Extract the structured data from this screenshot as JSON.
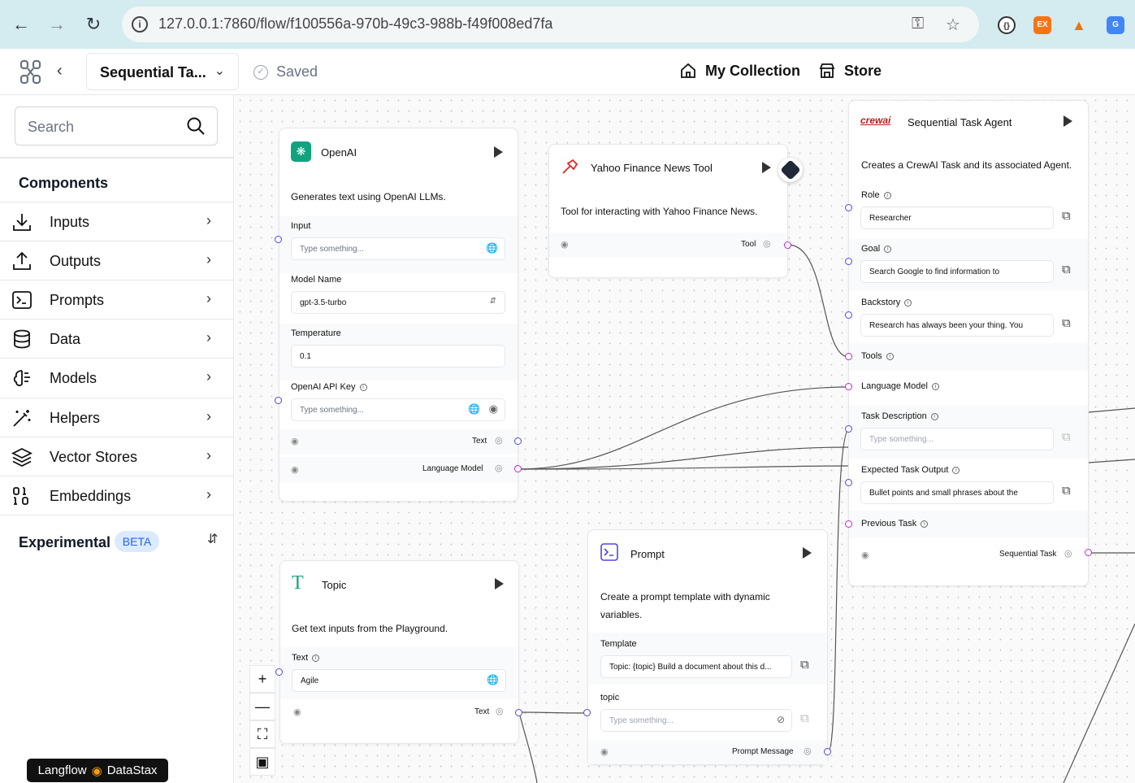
{
  "browser": {
    "url": "127.0.0.1:7860/flow/f100556a-970b-49c3-988b-f49f008ed7fa",
    "ext_ex": "EX"
  },
  "header": {
    "flow_name": "Sequential Ta...",
    "saved": "Saved",
    "my_collection": "My Collection",
    "store": "Store"
  },
  "sidebar": {
    "search_placeholder": "Search",
    "components_title": "Components",
    "items": [
      {
        "label": "Inputs",
        "icon": "download-icon"
      },
      {
        "label": "Outputs",
        "icon": "upload-icon"
      },
      {
        "label": "Prompts",
        "icon": "terminal-icon"
      },
      {
        "label": "Data",
        "icon": "database-icon"
      },
      {
        "label": "Models",
        "icon": "brain-icon"
      },
      {
        "label": "Helpers",
        "icon": "wand-icon"
      },
      {
        "label": "Vector Stores",
        "icon": "layers-icon"
      },
      {
        "label": "Embeddings",
        "icon": "binary-icon"
      }
    ],
    "experimental": "Experimental",
    "beta": "BETA"
  },
  "brand": {
    "left": "Langflow",
    "right": "DataStax"
  },
  "nodes": {
    "openai": {
      "title": "OpenAI",
      "description": "Generates text using OpenAI LLMs.",
      "input_label": "Input",
      "input_placeholder": "Type something...",
      "model_label": "Model Name",
      "model_value": "gpt-3.5-turbo",
      "temperature_label": "Temperature",
      "temperature_value": "0.1",
      "apikey_label": "OpenAI API Key",
      "apikey_placeholder": "Type something...",
      "out_text": "Text",
      "out_lm": "Language Model"
    },
    "yahoo": {
      "title": "Yahoo Finance News Tool",
      "description": "Tool for interacting with Yahoo Finance News.",
      "out_tool": "Tool"
    },
    "agent": {
      "title": "Sequential Task Agent",
      "logo_text": "crewai",
      "description": "Creates a CrewAI Task and its associated Agent.",
      "role_label": "Role",
      "role_value": "Researcher",
      "goal_label": "Goal",
      "goal_value": "Search Google to find information to",
      "backstory_label": "Backstory",
      "backstory_value": "Research has always been your thing. You",
      "tools_label": "Tools",
      "lm_label": "Language Model",
      "taskdesc_label": "Task Description",
      "taskdesc_placeholder": "Type something...",
      "expected_label": "Expected Task Output",
      "expected_value": "Bullet points and small phrases about the",
      "prev_label": "Previous Task",
      "out_seq": "Sequential Task"
    },
    "topic": {
      "title": "Topic",
      "description": "Get text inputs from the Playground.",
      "text_label": "Text",
      "text_value": "Agile",
      "out_text": "Text"
    },
    "prompt": {
      "title": "Prompt",
      "description": "Create a prompt template with dynamic variables.",
      "template_label": "Template",
      "template_value": "Topic: {topic} Build a document about this d...",
      "topic_label": "topic",
      "topic_placeholder": "Type something...",
      "out_msg": "Prompt Message"
    }
  },
  "colors": {
    "handle_blue": "#4f46e5",
    "handle_pink": "#c026d3",
    "openai_green": "#10a37f",
    "yahoo_red": "#dc2626",
    "beta_blue": "#2563eb"
  }
}
